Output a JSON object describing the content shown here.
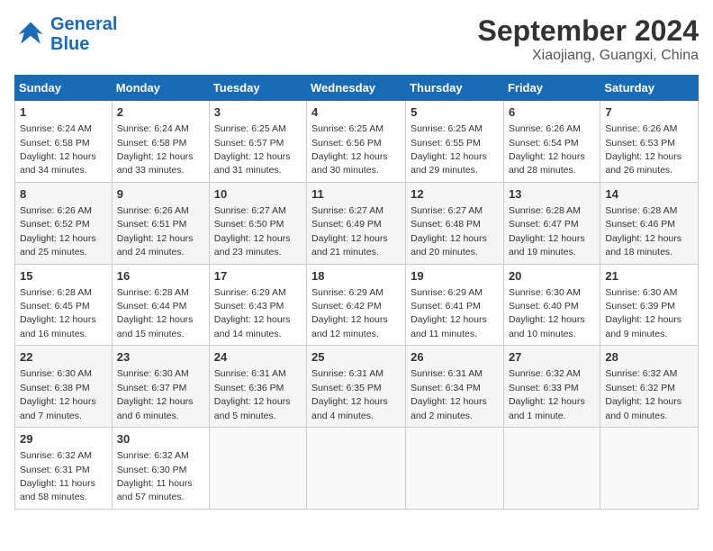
{
  "logo": {
    "general": "General",
    "blue": "Blue"
  },
  "title": "September 2024",
  "location": "Xiaojiang, Guangxi, China",
  "days_header": [
    "Sunday",
    "Monday",
    "Tuesday",
    "Wednesday",
    "Thursday",
    "Friday",
    "Saturday"
  ],
  "weeks": [
    [
      {
        "num": "1",
        "sunrise": "6:24 AM",
        "sunset": "6:58 PM",
        "daylight": "12 hours and 34 minutes."
      },
      {
        "num": "2",
        "sunrise": "6:24 AM",
        "sunset": "6:58 PM",
        "daylight": "12 hours and 33 minutes."
      },
      {
        "num": "3",
        "sunrise": "6:25 AM",
        "sunset": "6:57 PM",
        "daylight": "12 hours and 31 minutes."
      },
      {
        "num": "4",
        "sunrise": "6:25 AM",
        "sunset": "6:56 PM",
        "daylight": "12 hours and 30 minutes."
      },
      {
        "num": "5",
        "sunrise": "6:25 AM",
        "sunset": "6:55 PM",
        "daylight": "12 hours and 29 minutes."
      },
      {
        "num": "6",
        "sunrise": "6:26 AM",
        "sunset": "6:54 PM",
        "daylight": "12 hours and 28 minutes."
      },
      {
        "num": "7",
        "sunrise": "6:26 AM",
        "sunset": "6:53 PM",
        "daylight": "12 hours and 26 minutes."
      }
    ],
    [
      {
        "num": "8",
        "sunrise": "6:26 AM",
        "sunset": "6:52 PM",
        "daylight": "12 hours and 25 minutes."
      },
      {
        "num": "9",
        "sunrise": "6:26 AM",
        "sunset": "6:51 PM",
        "daylight": "12 hours and 24 minutes."
      },
      {
        "num": "10",
        "sunrise": "6:27 AM",
        "sunset": "6:50 PM",
        "daylight": "12 hours and 23 minutes."
      },
      {
        "num": "11",
        "sunrise": "6:27 AM",
        "sunset": "6:49 PM",
        "daylight": "12 hours and 21 minutes."
      },
      {
        "num": "12",
        "sunrise": "6:27 AM",
        "sunset": "6:48 PM",
        "daylight": "12 hours and 20 minutes."
      },
      {
        "num": "13",
        "sunrise": "6:28 AM",
        "sunset": "6:47 PM",
        "daylight": "12 hours and 19 minutes."
      },
      {
        "num": "14",
        "sunrise": "6:28 AM",
        "sunset": "6:46 PM",
        "daylight": "12 hours and 18 minutes."
      }
    ],
    [
      {
        "num": "15",
        "sunrise": "6:28 AM",
        "sunset": "6:45 PM",
        "daylight": "12 hours and 16 minutes."
      },
      {
        "num": "16",
        "sunrise": "6:28 AM",
        "sunset": "6:44 PM",
        "daylight": "12 hours and 15 minutes."
      },
      {
        "num": "17",
        "sunrise": "6:29 AM",
        "sunset": "6:43 PM",
        "daylight": "12 hours and 14 minutes."
      },
      {
        "num": "18",
        "sunrise": "6:29 AM",
        "sunset": "6:42 PM",
        "daylight": "12 hours and 12 minutes."
      },
      {
        "num": "19",
        "sunrise": "6:29 AM",
        "sunset": "6:41 PM",
        "daylight": "12 hours and 11 minutes."
      },
      {
        "num": "20",
        "sunrise": "6:30 AM",
        "sunset": "6:40 PM",
        "daylight": "12 hours and 10 minutes."
      },
      {
        "num": "21",
        "sunrise": "6:30 AM",
        "sunset": "6:39 PM",
        "daylight": "12 hours and 9 minutes."
      }
    ],
    [
      {
        "num": "22",
        "sunrise": "6:30 AM",
        "sunset": "6:38 PM",
        "daylight": "12 hours and 7 minutes."
      },
      {
        "num": "23",
        "sunrise": "6:30 AM",
        "sunset": "6:37 PM",
        "daylight": "12 hours and 6 minutes."
      },
      {
        "num": "24",
        "sunrise": "6:31 AM",
        "sunset": "6:36 PM",
        "daylight": "12 hours and 5 minutes."
      },
      {
        "num": "25",
        "sunrise": "6:31 AM",
        "sunset": "6:35 PM",
        "daylight": "12 hours and 4 minutes."
      },
      {
        "num": "26",
        "sunrise": "6:31 AM",
        "sunset": "6:34 PM",
        "daylight": "12 hours and 2 minutes."
      },
      {
        "num": "27",
        "sunrise": "6:32 AM",
        "sunset": "6:33 PM",
        "daylight": "12 hours and 1 minute."
      },
      {
        "num": "28",
        "sunrise": "6:32 AM",
        "sunset": "6:32 PM",
        "daylight": "12 hours and 0 minutes."
      }
    ],
    [
      {
        "num": "29",
        "sunrise": "6:32 AM",
        "sunset": "6:31 PM",
        "daylight": "11 hours and 58 minutes."
      },
      {
        "num": "30",
        "sunrise": "6:32 AM",
        "sunset": "6:30 PM",
        "daylight": "11 hours and 57 minutes."
      },
      null,
      null,
      null,
      null,
      null
    ]
  ]
}
